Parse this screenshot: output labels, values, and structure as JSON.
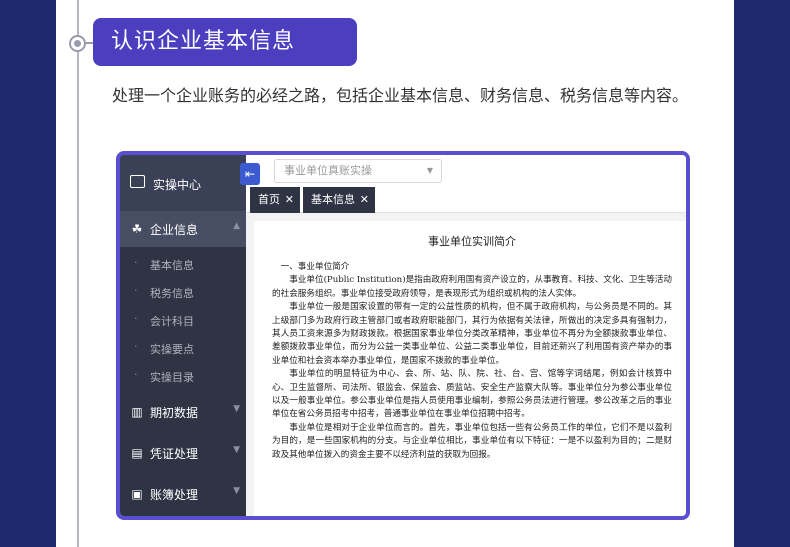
{
  "section": {
    "title": "认识企业基本信息",
    "description": "处理一个企业账务的必经之路，包括企业基本信息、财务信息、税务信息等内容。"
  },
  "app": {
    "brand": "实操中心",
    "collapse_icon": "arrow-left-icon",
    "select_placeholder": "事业单位真账实操",
    "menu": {
      "company_info": "企业信息",
      "sub_items": [
        "基本信息",
        "税务信息",
        "会计科目",
        "实操要点",
        "实操目录"
      ],
      "opening_data": "期初数据",
      "voucher": "凭证处理",
      "ledger": "账簿处理"
    },
    "tabs": [
      {
        "label": "首页"
      },
      {
        "label": "基本信息"
      }
    ]
  },
  "doc": {
    "title": "事业单位实训简介",
    "heading1": "一、事业单位简介",
    "p1": "事业单位(Public Institution)是指由政府利用国有资产设立的，从事教育、科技、文化、卫生等活动的社会服务组织。事业单位接受政府领导，是表现形式为组织或机构的法人实体。",
    "p2": "事业单位一般是国家设置的带有一定的公益性质的机构，但不属于政府机构，与公务员是不同的。其上级部门多为政府行政主管部门或者政府职能部门，其行为依据有关法律，所做出的决定多具有强制力，其人员工资来源多为财政拨款。根据国家事业单位分类改革精神，事业单位不再分为全额拨款事业单位、差额拨款事业单位，而分为公益一类事业单位、公益二类事业单位，目前还新兴了利用国有资产举办的事业单位和社会资本举办事业单位，是国家不拨款的事业单位。",
    "p3": "事业单位的明显特征为中心、会、所、站、队、院、社、台、宫、馆等字词结尾，例如会计核算中心、卫生监督所、司法所、银监会、保监会、质监站、安全生产监察大队等。事业单位分为参公事业单位以及一般事业单位。参公事业单位是指人员使用事业编制，参照公务员法进行管理。参公改革之后的事业单位在省公务员招考中招考，普通事业单位在事业单位招聘中招考。",
    "p4": "事业单位是相对于企业单位而言的。首先，事业单位包括一些有公务员工作的单位，它们不是以盈利为目的，是一些国家机构的分支。与企业单位相比，事业单位有以下特征：一是不以盈利为目的；二是财政及其他单位拨入的资金主要不以经济利益的获取为回报。"
  }
}
